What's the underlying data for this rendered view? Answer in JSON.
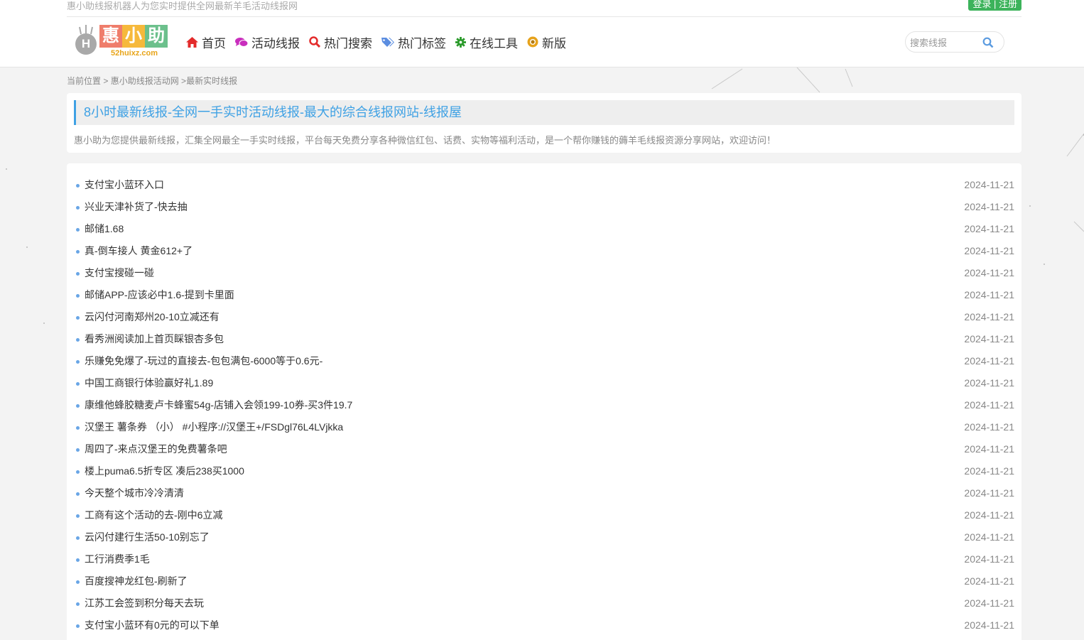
{
  "topbar": {
    "tagline": "惠小助线报机器人为您实时提供全网最新羊毛活动线报网",
    "login": "登录",
    "separator": "|",
    "register": "注册"
  },
  "logo": {
    "letter": "H",
    "chars": [
      "惠",
      "小",
      "助"
    ],
    "char_colors": [
      "#ef7d6b",
      "#f6b93b",
      "#6cc08c"
    ],
    "domain": "52huixz.com"
  },
  "nav": [
    {
      "label": "首页",
      "icon": "home-icon",
      "color": "#e32b2b"
    },
    {
      "label": "活动线报",
      "icon": "comments-icon",
      "color": "#c92ebd"
    },
    {
      "label": "热门搜索",
      "icon": "search-icon",
      "color": "#e32b2b"
    },
    {
      "label": "热门标签",
      "icon": "tags-icon",
      "color": "#5b8de0"
    },
    {
      "label": "在线工具",
      "icon": "gear-icon",
      "color": "#2a9a2a"
    },
    {
      "label": "新版",
      "icon": "chrome-icon",
      "color": "#e6a21b"
    }
  ],
  "search": {
    "placeholder": "搜索线报"
  },
  "breadcrumb": {
    "prefix": "当前位置",
    "sep1": " > ",
    "home": "惠小助线报活动网",
    "sep2": " >",
    "current": "最新实时线报"
  },
  "intro": {
    "title": "8小时最新线报-全网一手实时活动线报-最大的综合线报网站-线报屋",
    "description": "惠小助为您提供最新线报，汇集全网最全一手实时线报，平台每天免费分享各种微信红包、话费、实物等福利活动，是一个帮你赚钱的薅羊毛线报资源分享网站，欢迎访问！"
  },
  "colors": {
    "accent": "#3fa1e4",
    "dot": "#69a6e6",
    "auth_bg": "#3cb35b"
  },
  "posts": [
    {
      "title": "支付宝小蓝环入口",
      "date": "2024-11-21"
    },
    {
      "title": "兴业天津补货了-快去抽",
      "date": "2024-11-21"
    },
    {
      "title": "邮储1.68",
      "date": "2024-11-21"
    },
    {
      "title": "真-倒车接人 黄金612+了",
      "date": "2024-11-21"
    },
    {
      "title": "支付宝搜碰一碰",
      "date": "2024-11-21"
    },
    {
      "title": "邮储APP-应该必中1.6-提到卡里面",
      "date": "2024-11-21"
    },
    {
      "title": "云闪付河南郑州20-10立减还有",
      "date": "2024-11-21"
    },
    {
      "title": "看秀洲阅读加上首页睬银杏多包",
      "date": "2024-11-21"
    },
    {
      "title": "乐赚免免爆了-玩过的直接去-包包满包-6000等于0.6元-",
      "date": "2024-11-21"
    },
    {
      "title": "中国工商银行体验赢好礼1.89",
      "date": "2024-11-21"
    },
    {
      "title": "康维他蜂胶糖麦卢卡蜂蜜54g-店铺入会领199-10券-买3件19.7",
      "date": "2024-11-21"
    },
    {
      "title": "汉堡王 薯条券 （小） #小程序://汉堡王+/FSDgl76L4LVjkka",
      "date": "2024-11-21"
    },
    {
      "title": "周四了-来点汉堡王的免费薯条吧",
      "date": "2024-11-21"
    },
    {
      "title": "楼上puma6.5折专区 凑后238买1000",
      "date": "2024-11-21"
    },
    {
      "title": "今天整个城市冷冷清清",
      "date": "2024-11-21"
    },
    {
      "title": "工商有这个活动的去-刚中6立减",
      "date": "2024-11-21"
    },
    {
      "title": "云闪付建行生活50-10别忘了",
      "date": "2024-11-21"
    },
    {
      "title": "工行消费季1毛",
      "date": "2024-11-21"
    },
    {
      "title": "百度搜神龙红包-刷新了",
      "date": "2024-11-21"
    },
    {
      "title": "江苏工会签到积分每天去玩",
      "date": "2024-11-21"
    },
    {
      "title": "支付宝小蓝环有0元的可以下单",
      "date": "2024-11-21"
    }
  ]
}
